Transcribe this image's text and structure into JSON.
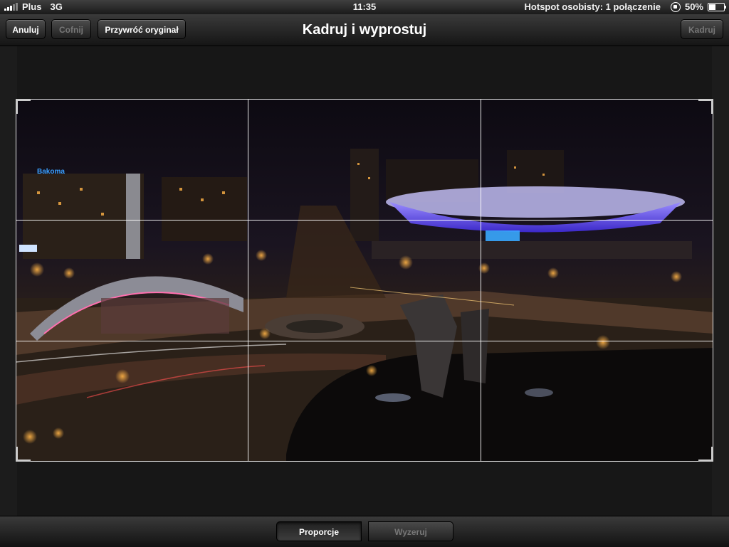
{
  "status_bar": {
    "carrier": "Plus",
    "network": "3G",
    "time": "11:35",
    "hotspot": "Hotspot osobisty: 1 połączenie",
    "battery_text": "50%",
    "battery_level": 0.5
  },
  "toolbar": {
    "cancel_label": "Anuluj",
    "undo_label": "Cofnij",
    "revert_label": "Przywróć oryginał",
    "title": "Kadruj i wyprostuj",
    "crop_label": "Kadruj"
  },
  "bottom_bar": {
    "proportions_label": "Proporcje",
    "reset_label": "Wyzeruj"
  }
}
